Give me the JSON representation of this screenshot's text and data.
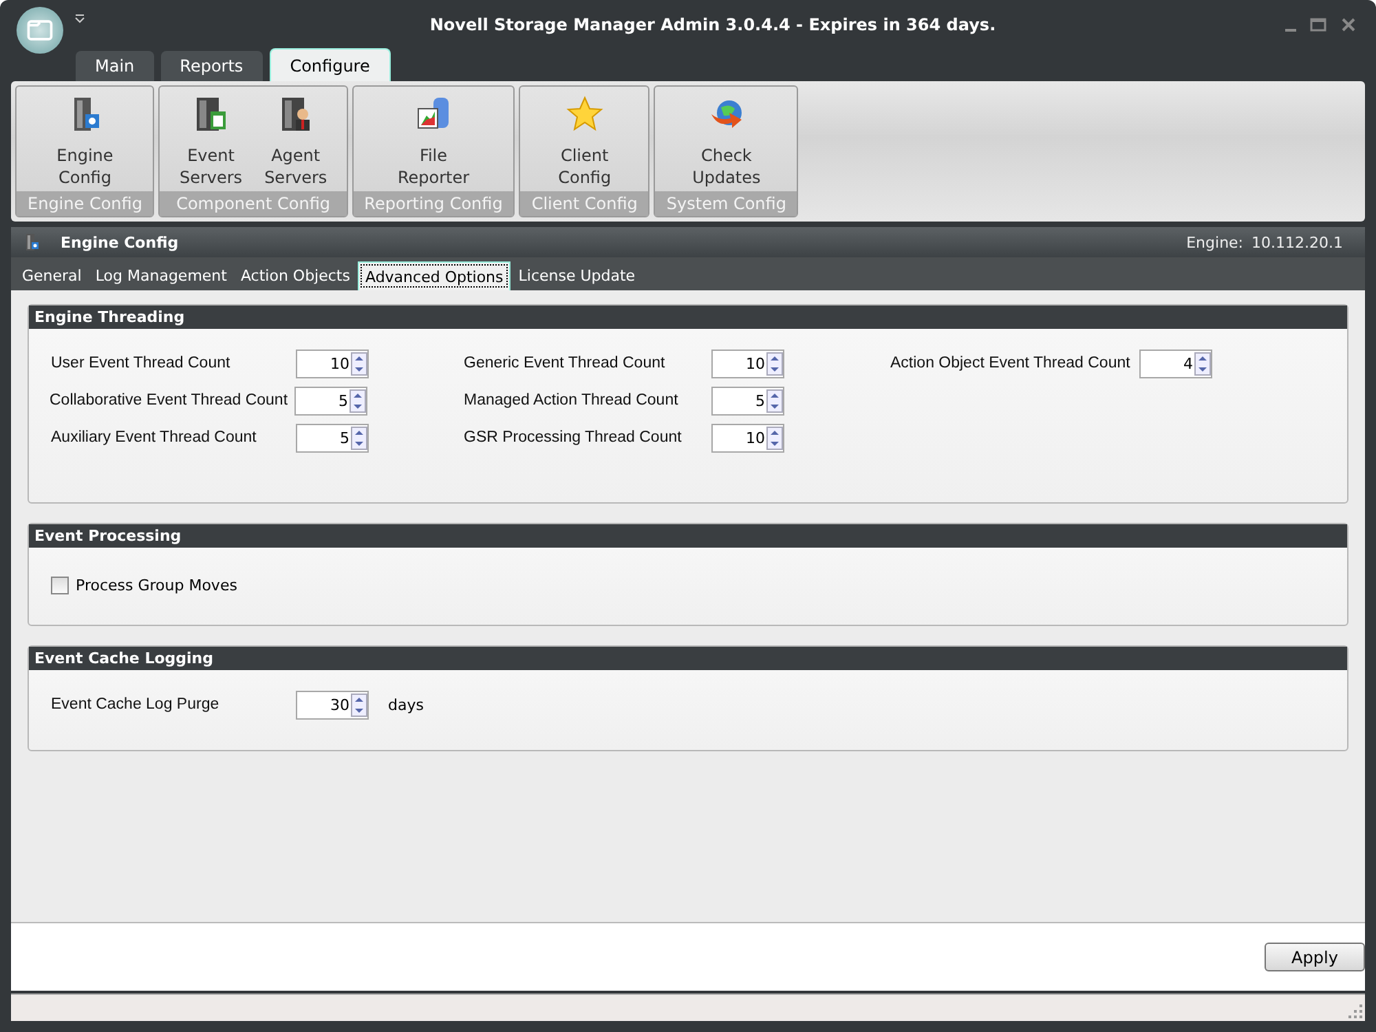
{
  "window": {
    "title": "Novell Storage Manager Admin 3.0.4.4 - Expires in 364 days."
  },
  "ribbon_tabs": [
    {
      "label": "Main",
      "selected": false
    },
    {
      "label": "Reports",
      "selected": false
    },
    {
      "label": "Configure",
      "selected": true
    }
  ],
  "ribbon_groups": [
    {
      "label": "Engine Config",
      "buttons": [
        {
          "lines": [
            "Engine",
            "Config"
          ]
        }
      ]
    },
    {
      "label": "Component Config",
      "buttons": [
        {
          "lines": [
            "Event",
            "Servers"
          ]
        },
        {
          "lines": [
            "Agent",
            "Servers"
          ]
        }
      ]
    },
    {
      "label": "Reporting Config",
      "buttons": [
        {
          "lines": [
            "File",
            "Reporter"
          ]
        }
      ]
    },
    {
      "label": "Client Config",
      "buttons": [
        {
          "lines": [
            "Client",
            "Config"
          ]
        }
      ]
    },
    {
      "label": "System Config",
      "buttons": [
        {
          "lines": [
            "Check",
            "Updates"
          ]
        }
      ]
    }
  ],
  "section": {
    "title": "Engine Config",
    "engine_label": "Engine:",
    "engine_value": "10.112.20.1"
  },
  "sub_tabs": [
    {
      "label": "General",
      "selected": false
    },
    {
      "label": "Log Management",
      "selected": false
    },
    {
      "label": "Action Objects",
      "selected": false
    },
    {
      "label": "Advanced Options",
      "selected": true
    },
    {
      "label": "License Update",
      "selected": false
    }
  ],
  "panels": [
    {
      "title": "Engine Threading",
      "kind": "spinners",
      "columns": [
        [
          {
            "label": "User Event Thread Count",
            "value": "10"
          },
          {
            "label": "Collaborative Event Thread Count",
            "value": "5"
          },
          {
            "label": "Auxiliary Event Thread Count",
            "value": "5"
          }
        ],
        [
          {
            "label": "Generic Event Thread Count",
            "value": "10"
          },
          {
            "label": "Managed Action Thread Count",
            "value": "5"
          },
          {
            "label": "GSR Processing Thread Count",
            "value": "10"
          }
        ],
        [
          {
            "label": "Action Object Event Thread Count",
            "value": "4"
          }
        ]
      ]
    },
    {
      "title": "Event Processing",
      "kind": "checkboxes",
      "items": [
        {
          "label": "Process Group Moves",
          "checked": false
        }
      ]
    },
    {
      "title": "Event Cache Logging",
      "kind": "spinner_unit",
      "label": "Event Cache Log Purge",
      "value": "30",
      "unit": "days"
    }
  ],
  "buttons": [
    "Apply"
  ]
}
